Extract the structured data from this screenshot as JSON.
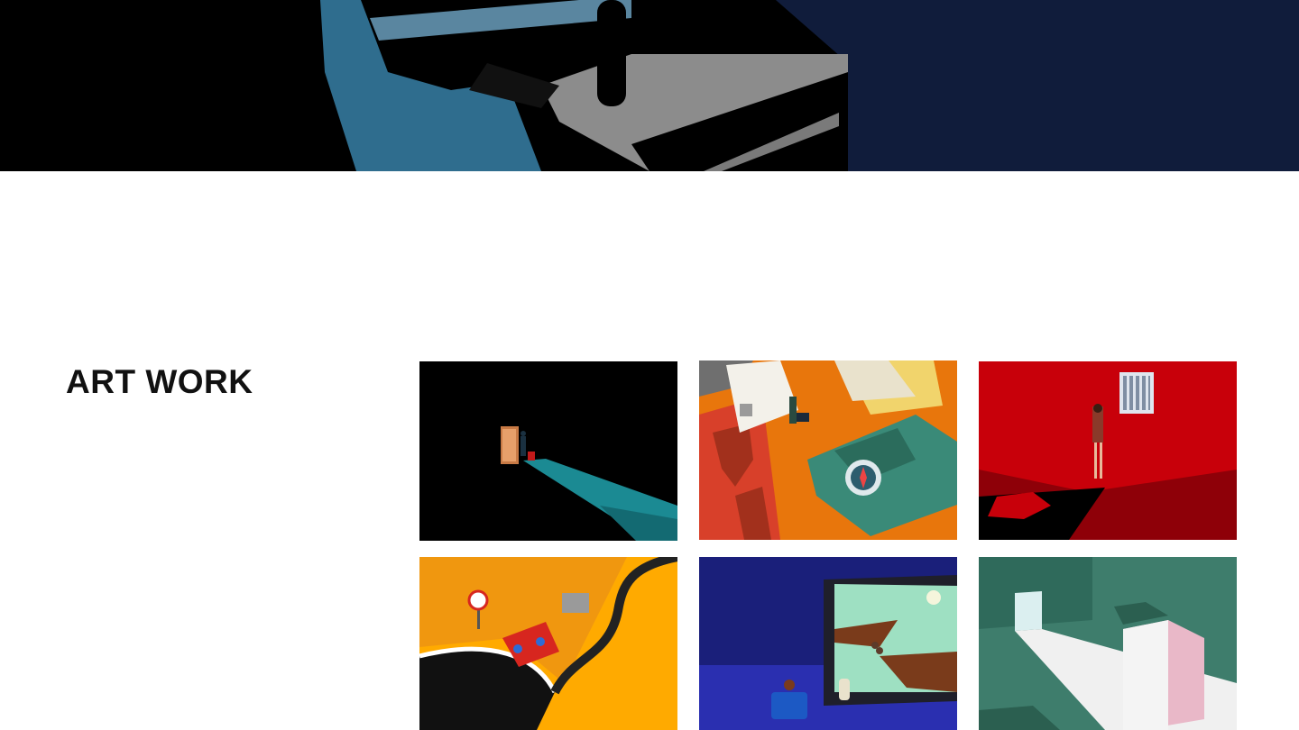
{
  "section": {
    "title": "ART WORK"
  },
  "hero": {
    "icon": "suitcase-handle-illustration"
  },
  "artworks": [
    {
      "name": "figure-with-suitcase-at-door-in-dark",
      "palette": [
        "#000000",
        "#1b8a93",
        "#c87a45"
      ]
    },
    {
      "name": "passport-and-map-notebook",
      "palette": [
        "#e8760c",
        "#d8402a",
        "#3a8a78"
      ]
    },
    {
      "name": "woman-at-prison-window-in-red",
      "palette": [
        "#c8000a",
        "#8e0008",
        "#7f8ea3"
      ]
    },
    {
      "name": "red-car-on-winding-road",
      "palette": [
        "#f0970f",
        "#d7261f",
        "#111111"
      ]
    },
    {
      "name": "tablet-with-ducks-and-viewer",
      "palette": [
        "#1a1f7a",
        "#9ee0c2",
        "#2a2a3a"
      ]
    },
    {
      "name": "green-room-with-building",
      "palette": [
        "#3e7d6c",
        "#f0f0f0",
        "#e9b8c8"
      ]
    }
  ]
}
